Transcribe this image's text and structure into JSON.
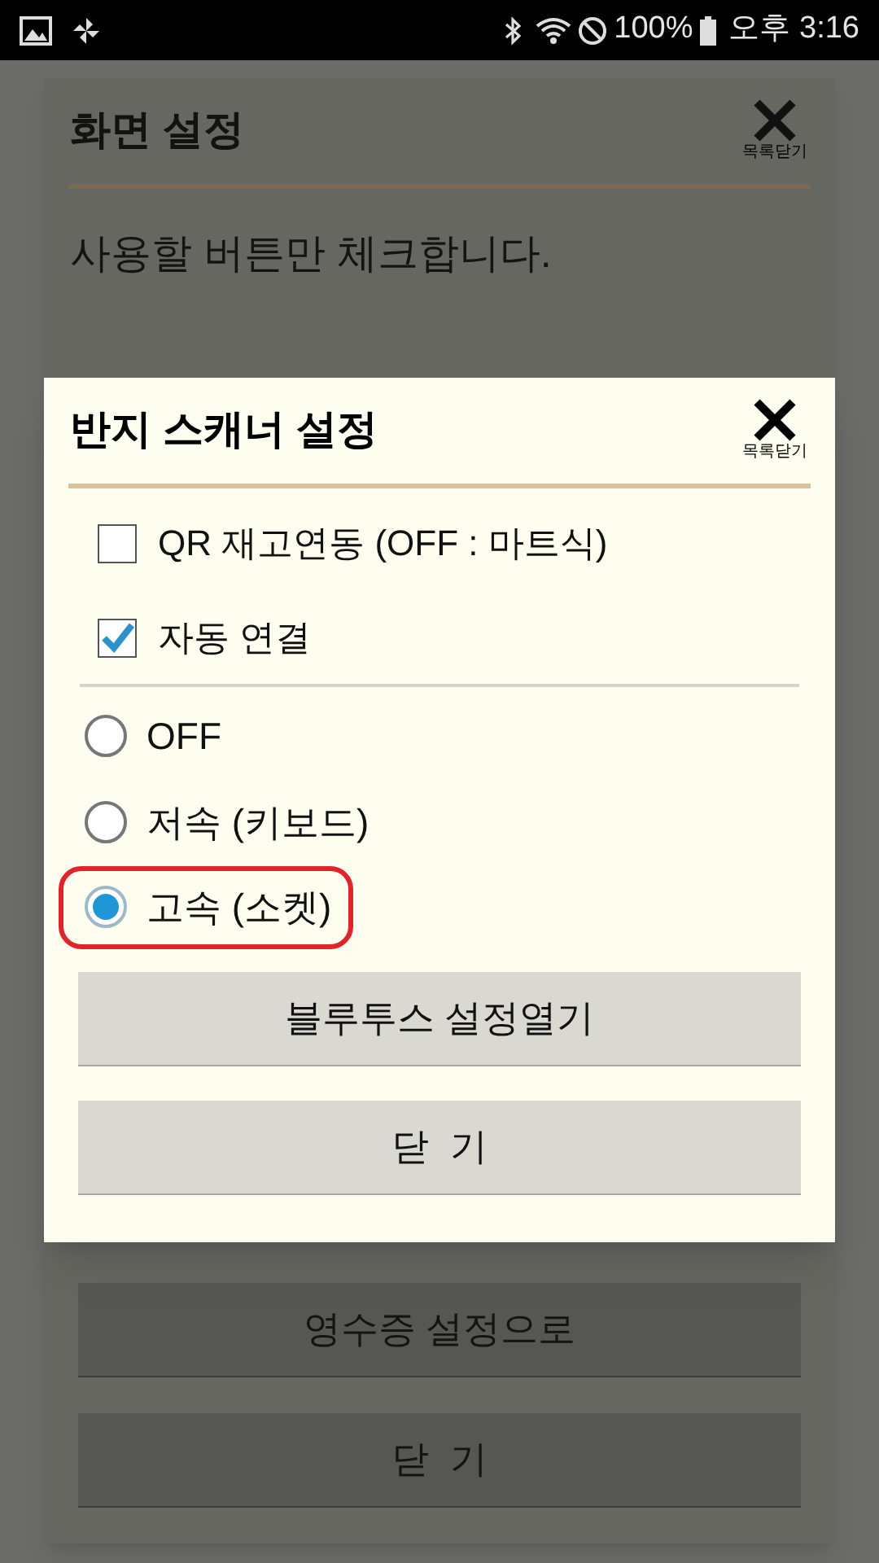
{
  "status_bar": {
    "battery": "100%",
    "time": "오후 3:16"
  },
  "back_dialog": {
    "title": "화면 설정",
    "close_caption": "목록닫기",
    "description": "사용할 버튼만 체크합니다.",
    "buttons": [
      "영수증 설정으로",
      "닫  기"
    ]
  },
  "dialog": {
    "title": "반지 스캐너 설정",
    "close_caption": "목록닫기",
    "checkboxes": [
      {
        "label": "QR 재고연동 (OFF : 마트식)",
        "checked": false
      },
      {
        "label": "자동 연결",
        "checked": true
      }
    ],
    "radios": [
      {
        "label": "OFF",
        "selected": false,
        "highlighted": false
      },
      {
        "label": "저속 (키보드)",
        "selected": false,
        "highlighted": false
      },
      {
        "label": "고속 (소켓)",
        "selected": true,
        "highlighted": true
      }
    ],
    "buttons": [
      "블루투스 설정열기",
      "닫  기"
    ]
  }
}
